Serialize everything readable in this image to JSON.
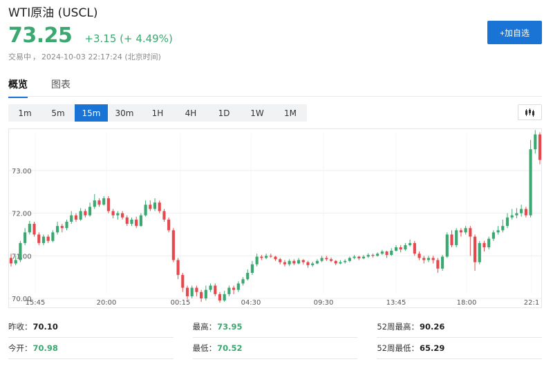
{
  "header": {
    "title": "WTI原油 (USCL)",
    "price": "73.25",
    "change": "+3.15 (+ 4.49%)",
    "status_label": "交易中",
    "status_sep": "，",
    "timestamp": "2024-10-03 22:17:24 (北京时间)"
  },
  "actions": {
    "add_watchlist": "+加自选"
  },
  "tabs": [
    {
      "label": "概览",
      "active": true
    },
    {
      "label": "图表",
      "active": false
    }
  ],
  "periods": [
    "1m",
    "5m",
    "15m",
    "30m",
    "1H",
    "4H",
    "1D",
    "1W",
    "1M"
  ],
  "active_period": "15m",
  "colors": {
    "up": "#3aa870",
    "down": "#e5494d",
    "accent": "#1a74d6",
    "grid": "#eeeeee"
  },
  "icons": {
    "chart_type": "candlestick-chart-icon"
  },
  "stats": {
    "prev_close": {
      "label": "昨收：",
      "value": "70.10"
    },
    "high": {
      "label": "最高：",
      "value": "73.95"
    },
    "high_52w": {
      "label": "52周最高：",
      "value": "90.26"
    },
    "open": {
      "label": "今开：",
      "value": "70.98"
    },
    "low": {
      "label": "最低：",
      "value": "70.52"
    },
    "low_52w": {
      "label": "52周最低：",
      "value": "65.29"
    }
  },
  "chart_data": {
    "type": "candlestick",
    "y_ticks": [
      "73.00",
      "72.00",
      "71.00",
      "70.00"
    ],
    "x_ticks": [
      "15:45",
      "20:00",
      "00:15",
      "04:30",
      "09:30",
      "13:45",
      "18:00",
      "22:1"
    ],
    "ylim": [
      69.8,
      73.95
    ],
    "grid": true,
    "candles": [
      [
        70.95,
        70.82,
        71.05,
        70.75
      ],
      [
        70.82,
        70.9,
        71.0,
        70.78
      ],
      [
        70.9,
        71.3,
        71.35,
        70.85
      ],
      [
        71.3,
        71.55,
        71.65,
        71.25
      ],
      [
        71.55,
        71.75,
        71.82,
        71.5
      ],
      [
        71.75,
        71.5,
        71.8,
        71.45
      ],
      [
        71.5,
        71.3,
        71.55,
        71.25
      ],
      [
        71.3,
        71.45,
        71.5,
        71.25
      ],
      [
        71.45,
        71.35,
        71.5,
        71.3
      ],
      [
        71.35,
        71.55,
        71.6,
        71.32
      ],
      [
        71.55,
        71.7,
        71.8,
        71.5
      ],
      [
        71.7,
        71.65,
        71.75,
        71.55
      ],
      [
        71.65,
        71.8,
        71.85,
        71.6
      ],
      [
        71.8,
        71.95,
        72.05,
        71.75
      ],
      [
        71.95,
        71.85,
        72.0,
        71.8
      ],
      [
        71.85,
        72.05,
        72.12,
        71.82
      ],
      [
        72.05,
        71.95,
        72.1,
        71.9
      ],
      [
        71.95,
        72.15,
        72.25,
        71.92
      ],
      [
        72.15,
        72.3,
        72.45,
        72.1
      ],
      [
        72.3,
        72.2,
        72.35,
        72.15
      ],
      [
        72.2,
        72.35,
        72.4,
        72.18
      ],
      [
        72.35,
        72.05,
        72.4,
        72.0
      ],
      [
        72.05,
        71.95,
        72.1,
        71.88
      ],
      [
        71.95,
        72.0,
        72.05,
        71.85
      ],
      [
        72.0,
        71.9,
        72.05,
        71.85
      ],
      [
        71.9,
        71.75,
        71.95,
        71.7
      ],
      [
        71.75,
        71.85,
        71.9,
        71.7
      ],
      [
        71.85,
        71.7,
        71.92,
        71.65
      ],
      [
        71.7,
        71.95,
        72.0,
        71.68
      ],
      [
        71.95,
        72.2,
        72.3,
        71.92
      ],
      [
        72.2,
        72.1,
        72.3,
        72.05
      ],
      [
        72.1,
        72.25,
        72.35,
        72.05
      ],
      [
        72.25,
        72.05,
        72.3,
        72.0
      ],
      [
        72.05,
        71.85,
        72.1,
        71.8
      ],
      [
        71.85,
        71.6,
        71.9,
        71.55
      ],
      [
        71.6,
        70.9,
        71.65,
        70.85
      ],
      [
        70.9,
        70.55,
        70.95,
        70.45
      ],
      [
        70.55,
        70.25,
        70.6,
        70.15
      ],
      [
        70.25,
        70.05,
        70.3,
        69.98
      ],
      [
        70.05,
        70.25,
        70.3,
        70.0
      ],
      [
        70.25,
        70.15,
        70.3,
        70.05
      ],
      [
        70.15,
        70.0,
        70.2,
        69.92
      ],
      [
        70.0,
        70.2,
        70.3,
        69.95
      ],
      [
        70.2,
        70.3,
        70.35,
        70.15
      ],
      [
        70.3,
        70.1,
        70.35,
        70.05
      ],
      [
        70.1,
        69.95,
        70.15,
        69.9
      ],
      [
        69.95,
        70.1,
        70.18,
        69.92
      ],
      [
        70.1,
        70.25,
        70.3,
        70.05
      ],
      [
        70.25,
        70.2,
        70.3,
        70.1
      ],
      [
        70.2,
        70.35,
        70.4,
        70.15
      ],
      [
        70.35,
        70.45,
        70.5,
        70.3
      ],
      [
        70.45,
        70.6,
        70.68,
        70.42
      ],
      [
        70.6,
        70.8,
        70.88,
        70.55
      ],
      [
        70.8,
        70.98,
        71.05,
        70.75
      ],
      [
        70.98,
        70.95,
        71.02,
        70.9
      ],
      [
        70.95,
        71.0,
        71.05,
        70.92
      ],
      [
        71.0,
        70.98,
        71.05,
        70.95
      ],
      [
        70.98,
        70.92,
        71.0,
        70.88
      ],
      [
        70.92,
        70.85,
        70.95,
        70.8
      ],
      [
        70.85,
        70.8,
        70.9,
        70.75
      ],
      [
        70.8,
        70.88,
        70.92,
        70.76
      ],
      [
        70.88,
        70.82,
        70.92,
        70.78
      ],
      [
        70.82,
        70.9,
        70.95,
        70.8
      ],
      [
        70.9,
        70.85,
        70.92,
        70.8
      ],
      [
        70.85,
        70.78,
        70.88,
        70.72
      ],
      [
        70.78,
        70.82,
        70.86,
        70.74
      ],
      [
        70.82,
        70.88,
        70.92,
        70.8
      ],
      [
        70.88,
        70.95,
        71.0,
        70.85
      ],
      [
        70.95,
        70.92,
        71.0,
        70.88
      ],
      [
        70.92,
        70.88,
        70.96,
        70.85
      ],
      [
        70.88,
        70.82,
        70.9,
        70.78
      ],
      [
        70.82,
        70.85,
        70.9,
        70.8
      ],
      [
        70.85,
        70.88,
        70.92,
        70.82
      ],
      [
        70.88,
        70.95,
        70.98,
        70.85
      ],
      [
        70.95,
        70.98,
        71.02,
        70.92
      ],
      [
        70.98,
        70.94,
        71.0,
        70.9
      ],
      [
        70.94,
        70.98,
        71.02,
        70.92
      ],
      [
        70.98,
        71.02,
        71.06,
        70.95
      ],
      [
        71.02,
        71.0,
        71.05,
        70.96
      ],
      [
        71.0,
        71.05,
        71.08,
        70.98
      ],
      [
        71.05,
        71.1,
        71.14,
        71.02
      ],
      [
        71.1,
        71.02,
        71.12,
        70.95
      ],
      [
        71.02,
        71.12,
        71.18,
        71.0
      ],
      [
        71.12,
        71.2,
        71.25,
        71.1
      ],
      [
        71.2,
        71.15,
        71.25,
        71.08
      ],
      [
        71.15,
        71.25,
        71.3,
        71.12
      ],
      [
        71.25,
        71.3,
        71.38,
        71.22
      ],
      [
        71.3,
        71.05,
        71.35,
        71.0
      ],
      [
        71.05,
        70.95,
        71.1,
        70.9
      ],
      [
        70.95,
        70.9,
        71.0,
        70.82
      ],
      [
        70.9,
        70.95,
        71.0,
        70.85
      ],
      [
        70.95,
        70.9,
        71.0,
        70.82
      ],
      [
        70.9,
        70.7,
        70.95,
        70.6
      ],
      [
        70.7,
        70.98,
        71.02,
        70.65
      ],
      [
        70.98,
        71.5,
        71.55,
        70.95
      ],
      [
        71.5,
        71.25,
        71.6,
        71.2
      ],
      [
        71.25,
        71.6,
        71.65,
        71.2
      ],
      [
        71.6,
        71.55,
        71.65,
        71.45
      ],
      [
        71.55,
        71.65,
        71.7,
        71.5
      ],
      [
        71.65,
        71.45,
        71.7,
        71.0
      ],
      [
        71.45,
        70.85,
        71.5,
        70.65
      ],
      [
        70.85,
        71.3,
        71.35,
        70.8
      ],
      [
        71.3,
        71.2,
        71.35,
        71.1
      ],
      [
        71.2,
        71.4,
        71.45,
        71.15
      ],
      [
        71.4,
        71.55,
        71.6,
        71.35
      ],
      [
        71.55,
        71.6,
        71.7,
        71.5
      ],
      [
        71.6,
        71.7,
        71.85,
        71.55
      ],
      [
        71.7,
        71.9,
        72.0,
        71.65
      ],
      [
        71.9,
        71.95,
        72.1,
        71.85
      ],
      [
        71.95,
        72.0,
        72.12,
        71.88
      ],
      [
        72.0,
        72.1,
        72.2,
        71.92
      ],
      [
        72.1,
        71.95,
        72.15,
        71.9
      ],
      [
        71.95,
        73.5,
        73.72,
        71.9
      ],
      [
        73.5,
        73.85,
        73.95,
        73.4
      ],
      [
        73.85,
        73.25,
        73.9,
        73.15
      ]
    ]
  }
}
